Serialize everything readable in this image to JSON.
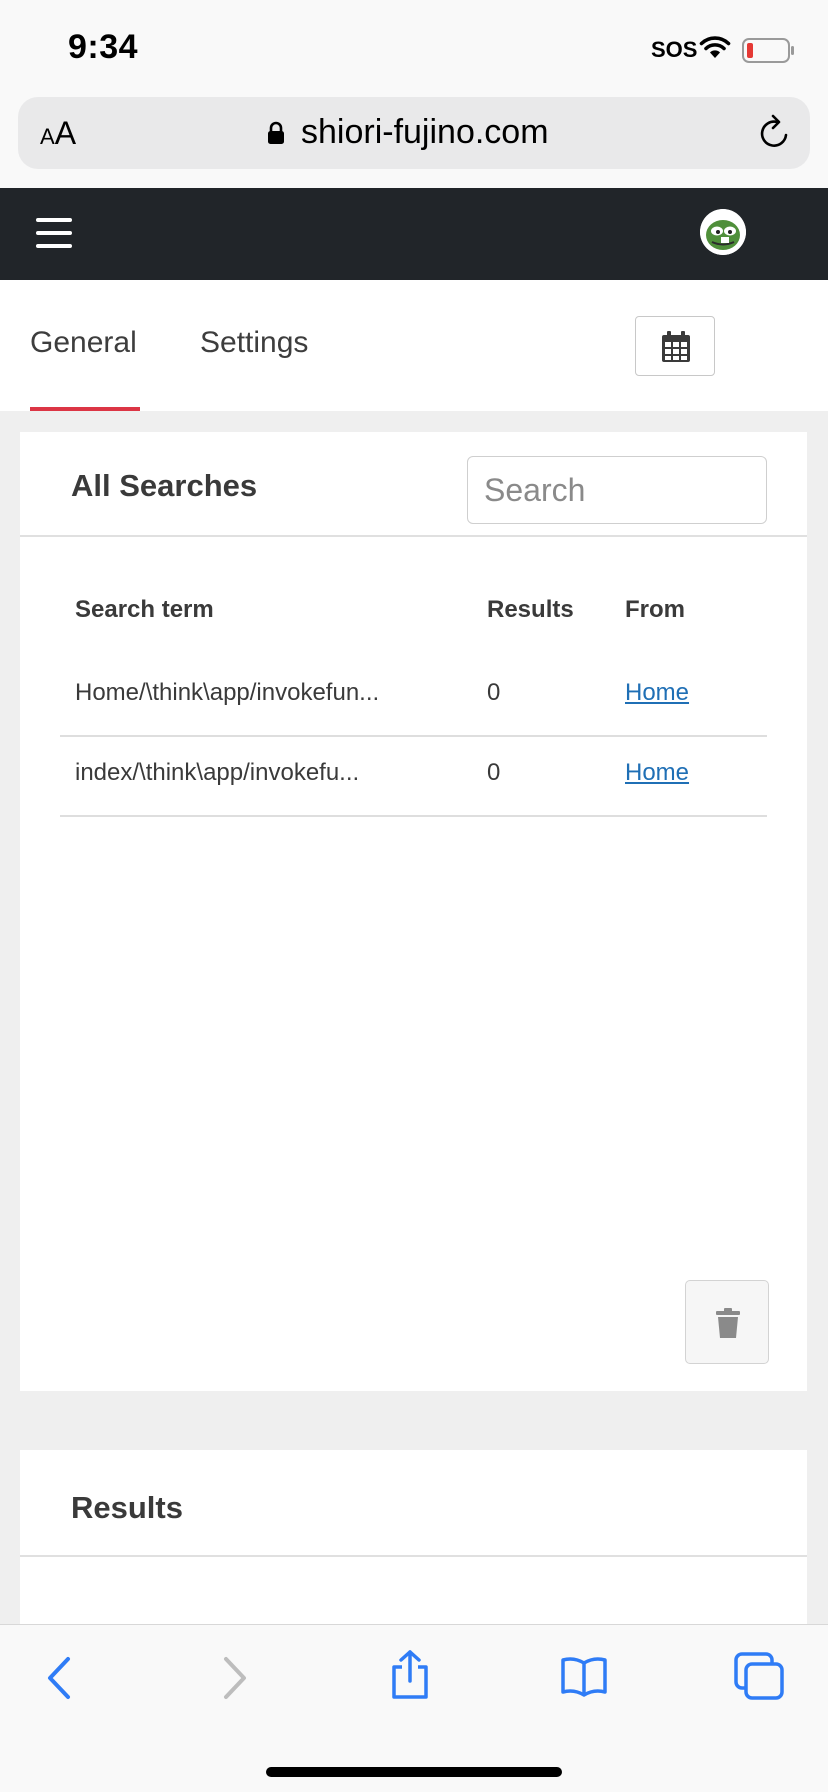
{
  "status_bar": {
    "time": "9:34",
    "carrier": "SOS"
  },
  "browser": {
    "text_size_label_small": "A",
    "text_size_label_large": "A",
    "url": "shiori-fujino.com"
  },
  "tabs": [
    {
      "label": "General",
      "active": true
    },
    {
      "label": "Settings",
      "active": false
    }
  ],
  "searches_card": {
    "title": "All Searches",
    "search_placeholder": "Search",
    "columns": {
      "term": "Search term",
      "results": "Results",
      "from": "From"
    },
    "rows": [
      {
        "term": "Home/\\think\\app/invokefun...",
        "results": "0",
        "from": "Home"
      },
      {
        "term": "index/\\think\\app/invokefu...",
        "results": "0",
        "from": "Home"
      }
    ]
  },
  "results_card": {
    "title": "Results"
  },
  "colors": {
    "navbar": "#212529",
    "active_tab": "#dc3545",
    "link": "#1f6fb5",
    "safari_blue": "#2f7cf6"
  }
}
